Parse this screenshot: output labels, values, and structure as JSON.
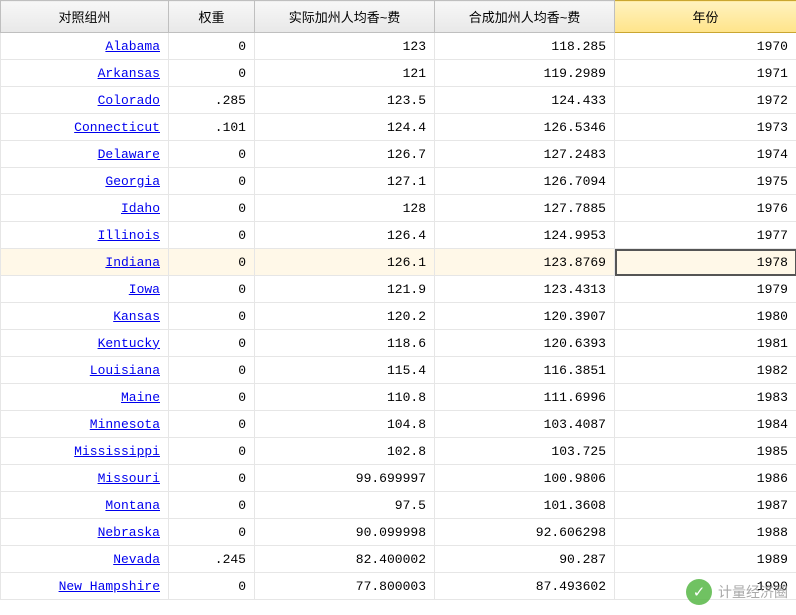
{
  "headers": {
    "state": "对照组州",
    "weight": "权重",
    "actual": "实际加州人均香~费",
    "synth": "合成加州人均香~费",
    "year": "年份"
  },
  "rows": [
    {
      "state": "Alabama",
      "weight": "0",
      "actual": "123",
      "synth": "118.285",
      "year": "1970"
    },
    {
      "state": "Arkansas",
      "weight": "0",
      "actual": "121",
      "synth": "119.2989",
      "year": "1971"
    },
    {
      "state": "Colorado",
      "weight": ".285",
      "actual": "123.5",
      "synth": "124.433",
      "year": "1972"
    },
    {
      "state": "Connecticut",
      "weight": ".101",
      "actual": "124.4",
      "synth": "126.5346",
      "year": "1973"
    },
    {
      "state": "Delaware",
      "weight": "0",
      "actual": "126.7",
      "synth": "127.2483",
      "year": "1974"
    },
    {
      "state": "Georgia",
      "weight": "0",
      "actual": "127.1",
      "synth": "126.7094",
      "year": "1975"
    },
    {
      "state": "Idaho",
      "weight": "0",
      "actual": "128",
      "synth": "127.7885",
      "year": "1976"
    },
    {
      "state": "Illinois",
      "weight": "0",
      "actual": "126.4",
      "synth": "124.9953",
      "year": "1977"
    },
    {
      "state": "Indiana",
      "weight": "0",
      "actual": "126.1",
      "synth": "123.8769",
      "year": "1978"
    },
    {
      "state": "Iowa",
      "weight": "0",
      "actual": "121.9",
      "synth": "123.4313",
      "year": "1979"
    },
    {
      "state": "Kansas",
      "weight": "0",
      "actual": "120.2",
      "synth": "120.3907",
      "year": "1980"
    },
    {
      "state": "Kentucky",
      "weight": "0",
      "actual": "118.6",
      "synth": "120.6393",
      "year": "1981"
    },
    {
      "state": "Louisiana",
      "weight": "0",
      "actual": "115.4",
      "synth": "116.3851",
      "year": "1982"
    },
    {
      "state": "Maine",
      "weight": "0",
      "actual": "110.8",
      "synth": "111.6996",
      "year": "1983"
    },
    {
      "state": "Minnesota",
      "weight": "0",
      "actual": "104.8",
      "synth": "103.4087",
      "year": "1984"
    },
    {
      "state": "Mississippi",
      "weight": "0",
      "actual": "102.8",
      "synth": "103.725",
      "year": "1985"
    },
    {
      "state": "Missouri",
      "weight": "0",
      "actual": "99.699997",
      "synth": "100.9806",
      "year": "1986"
    },
    {
      "state": "Montana",
      "weight": "0",
      "actual": "97.5",
      "synth": "101.3608",
      "year": "1987"
    },
    {
      "state": "Nebraska",
      "weight": "0",
      "actual": "90.099998",
      "synth": "92.606298",
      "year": "1988"
    },
    {
      "state": "Nevada",
      "weight": ".245",
      "actual": "82.400002",
      "synth": "90.287",
      "year": "1989"
    },
    {
      "state": "New Hampshire",
      "weight": "0",
      "actual": "77.800003",
      "synth": "87.493602",
      "year": "1990"
    }
  ],
  "selected_row_index": 8,
  "highlighted_col": "year",
  "watermark": {
    "icon": "✓",
    "text": "计量经济圈"
  }
}
